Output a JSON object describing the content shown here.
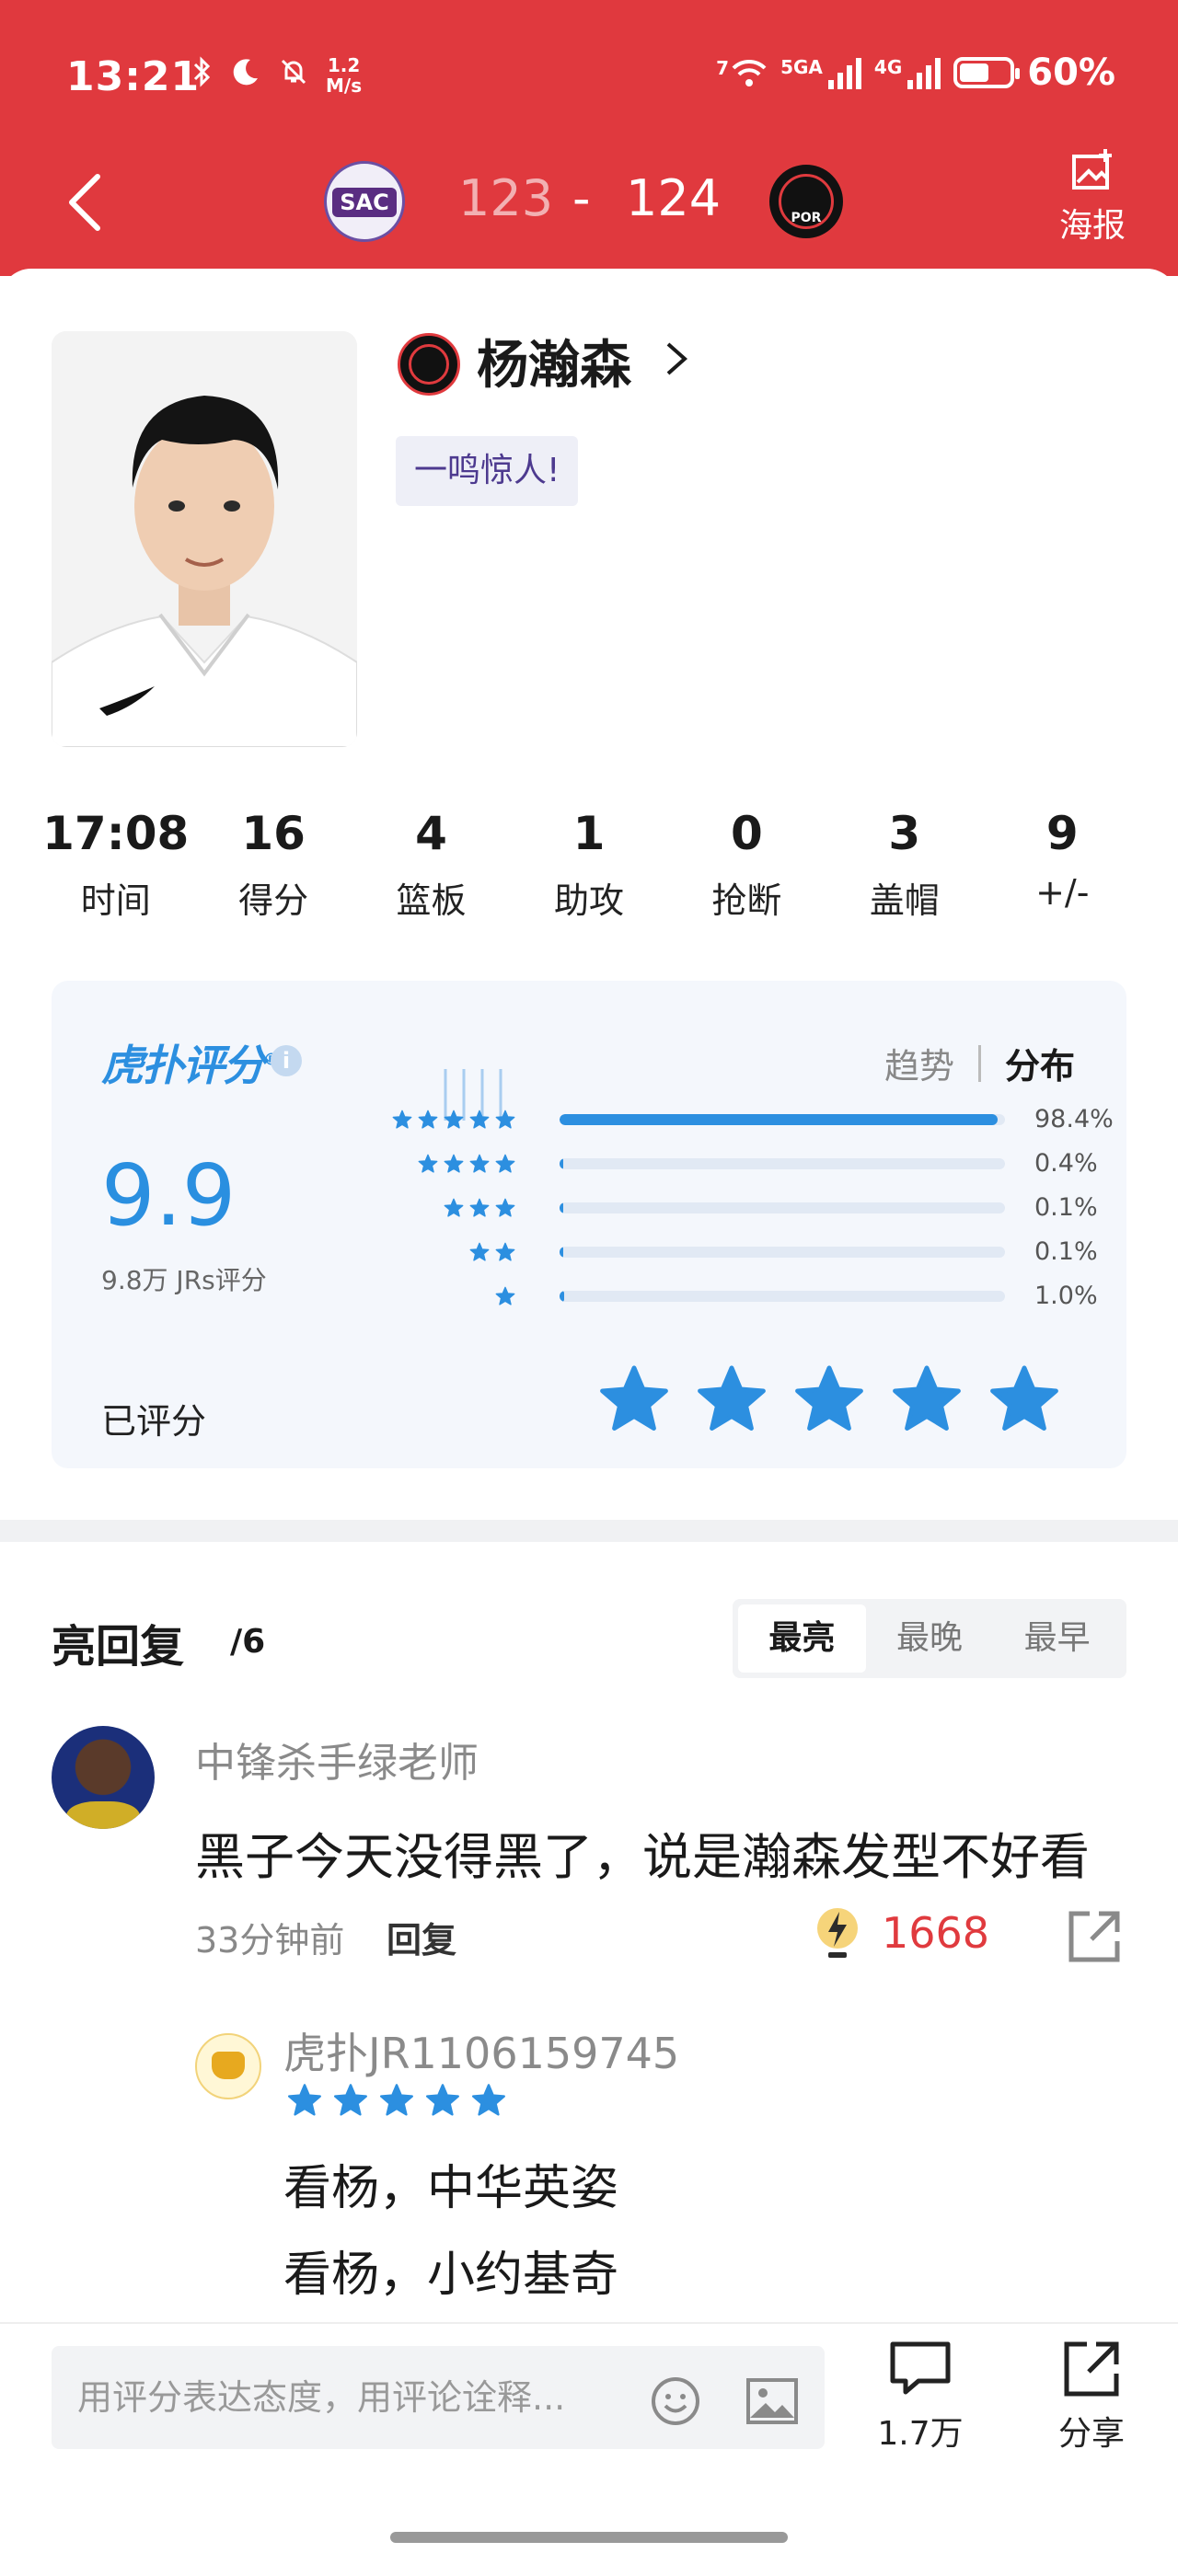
{
  "status_bar": {
    "time": "13:21",
    "speed_value": "1.2",
    "speed_unit": "M/s",
    "wifi_label": "7",
    "net_5g": "5GA",
    "net_4g": "4G",
    "battery": "60%",
    "battery_level": 0.6
  },
  "header": {
    "home_team": "SAC",
    "away_team": "POR",
    "home_score": "123",
    "separator": "-",
    "away_score": "124",
    "poster_label": "海报"
  },
  "player": {
    "name": "杨瀚森",
    "tag": "一鸣惊人!"
  },
  "stats": [
    {
      "value": "17:08",
      "label": "时间"
    },
    {
      "value": "16",
      "label": "得分"
    },
    {
      "value": "4",
      "label": "篮板"
    },
    {
      "value": "1",
      "label": "助攻"
    },
    {
      "value": "0",
      "label": "抢断"
    },
    {
      "value": "3",
      "label": "盖帽"
    },
    {
      "value": "9",
      "label": "+/-"
    }
  ],
  "rating": {
    "brand": "虎扑评分",
    "brand_mark": "®",
    "info_icon": "i",
    "tab_trend": "趋势",
    "tab_distribution": "分布",
    "score": "9.9",
    "count": "9.8万 JRs评分",
    "distribution": [
      {
        "stars": 5,
        "percent_label": "98.4%",
        "percent": 98.4
      },
      {
        "stars": 4,
        "percent_label": "0.4%",
        "percent": 0.4
      },
      {
        "stars": 3,
        "percent_label": "0.1%",
        "percent": 0.1
      },
      {
        "stars": 2,
        "percent_label": "0.1%",
        "percent": 0.1
      },
      {
        "stars": 1,
        "percent_label": "1.0%",
        "percent": 1.0
      }
    ],
    "rated_label": "已评分",
    "user_rating": 5
  },
  "comments": {
    "title": "亮回复",
    "count": "/6",
    "sort_tabs": [
      "最亮",
      "最晚",
      "最早"
    ],
    "active_sort": 0,
    "top_comment": {
      "user": "中锋杀手绿老师",
      "text": "黑子今天没得黑了，说是瀚森发型不好看",
      "time": "33分钟前",
      "reply_label": "回复",
      "likes": "1668"
    },
    "reply": {
      "user": "虎扑JR1106159745",
      "stars": 5,
      "line1": "看杨，中华英姿",
      "line2": "看杨，小约基奇"
    }
  },
  "bottom_bar": {
    "input_placeholder": "用评分表达态度，用评论诠释...",
    "comment_count": "1.7万",
    "share_label": "分享"
  },
  "colors": {
    "header_red": "#e0393e",
    "rating_blue": "#2c8fe0",
    "likes_red": "#e03a3e",
    "tag_bg": "#eeeff7",
    "tag_text": "#4d3a8f"
  }
}
